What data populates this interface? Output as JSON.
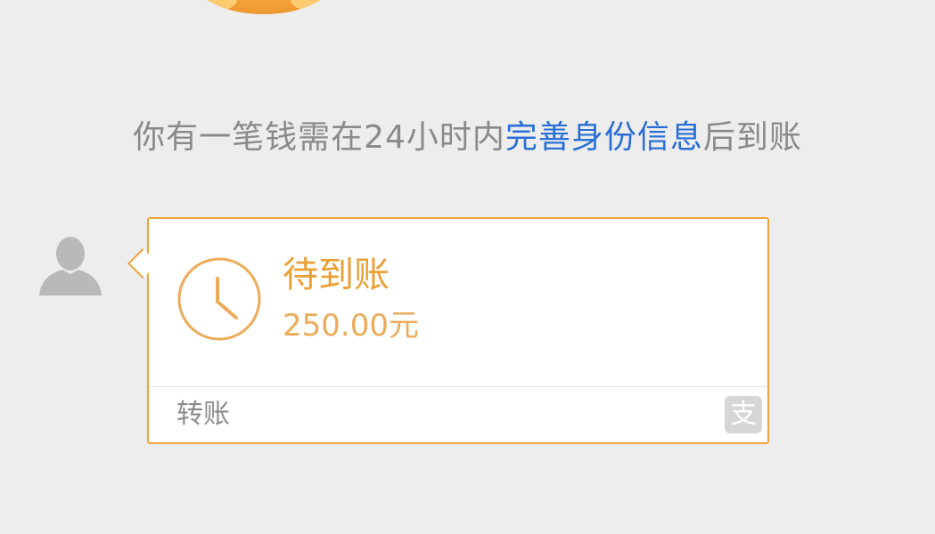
{
  "system_notice": {
    "prefix": "你有一笔钱需在24小时内",
    "link_text": "完善身份信息",
    "suffix": "后到账"
  },
  "transfer_card": {
    "status": "待到账",
    "amount": "250.00元",
    "type_label": "转账",
    "brand_icon_glyph": "支"
  },
  "icons": {
    "avatar": "default-user-avatar-icon",
    "clock": "clock-icon",
    "brand": "alipay-icon"
  },
  "colors": {
    "background": "#ededed",
    "accent_orange": "#f0a33a",
    "link_blue": "#2a6fd6",
    "notice_gray": "#8a8a8a"
  }
}
